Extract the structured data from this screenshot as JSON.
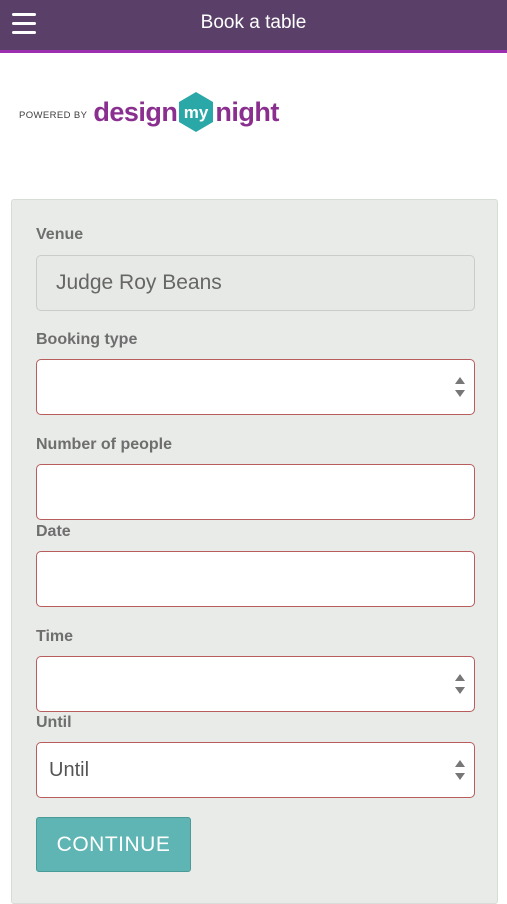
{
  "header": {
    "title": "Book a table",
    "menu_icon": "hamburger-menu-icon",
    "bar_color": "#5a4068",
    "accent_color": "#9c2fb0"
  },
  "brand": {
    "powered_by": "POWERED BY",
    "word_left": "design",
    "word_mid": "my",
    "word_right": "night",
    "purple": "#8a2f8f",
    "teal": "#2aa8a8"
  },
  "form": {
    "venue": {
      "label": "Venue",
      "value": "Judge Roy Beans"
    },
    "booking_type": {
      "label": "Booking type",
      "value": ""
    },
    "people": {
      "label": "Number of people",
      "value": ""
    },
    "date": {
      "label": "Date",
      "value": ""
    },
    "time": {
      "label": "Time",
      "value": ""
    },
    "until": {
      "label": "Until",
      "value": "Until"
    },
    "continue_label": "CONTINUE",
    "button_color": "#5fb5b3"
  }
}
